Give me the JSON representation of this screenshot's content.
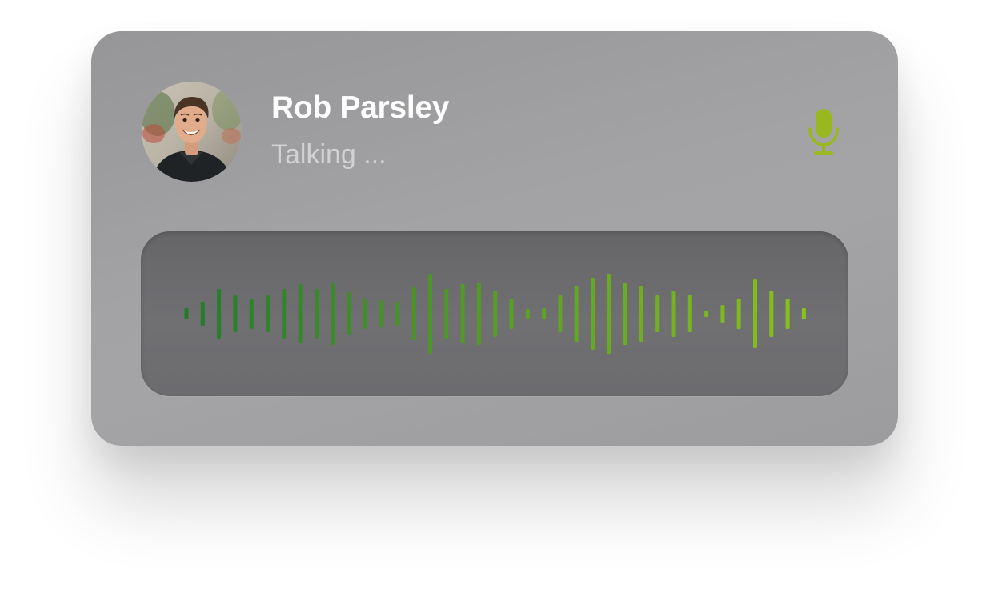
{
  "caller": {
    "name": "Rob Parsley",
    "status": "Talking ..."
  },
  "icons": {
    "avatar": "user-photo",
    "mic": "microphone-icon"
  },
  "colors": {
    "mic": "#99b81f",
    "wave_start": "#237a2c",
    "wave_end": "#88c21c"
  },
  "waveform": {
    "levels": [
      0.14,
      0.3,
      0.62,
      0.46,
      0.38,
      0.46,
      0.62,
      0.74,
      0.62,
      0.78,
      0.54,
      0.38,
      0.34,
      0.3,
      0.66,
      1.0,
      0.62,
      0.74,
      0.78,
      0.58,
      0.38,
      0.12,
      0.14,
      0.46,
      0.7,
      0.9,
      1.0,
      0.78,
      0.7,
      0.46,
      0.58,
      0.46,
      0.08,
      0.22,
      0.38,
      0.86,
      0.58,
      0.38,
      0.14
    ]
  }
}
